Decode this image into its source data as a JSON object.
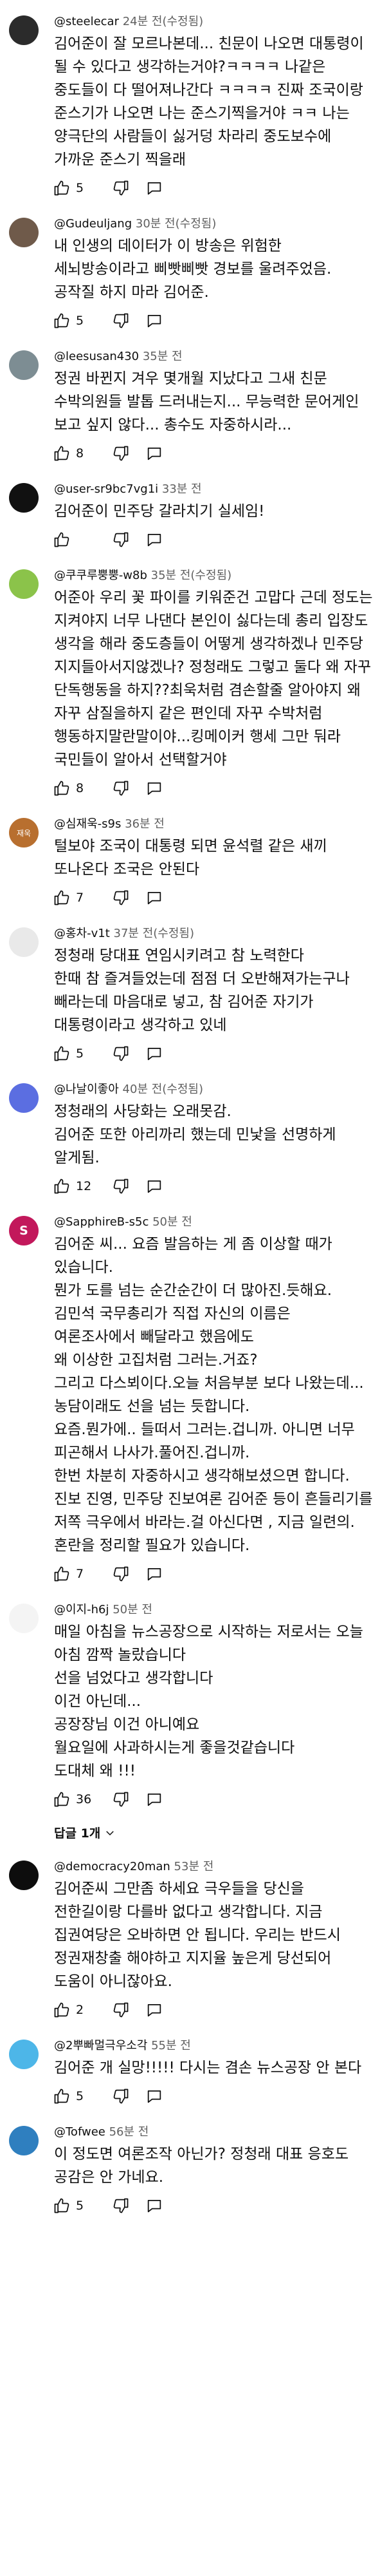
{
  "comments": [
    {
      "author": "@steelecar",
      "time": "24분 전(수정됨)",
      "avatar_color": "#2b2b2b",
      "avatar_text": "",
      "body": "김어준이 잘 모르나본데... 친문이 나오면 대통령이 될 수 있다고 생각하는거야?ㅋㅋㅋㅋ 나같은 중도들이 다 떨어져나간다 ㅋㅋㅋㅋ 진짜 조국이랑 준스기가 나오면 나는 준스기찍을거야 ㅋㅋ 나는 양극단의 사람들이 싫거덩 차라리 중도보수에 가까운 준스기 찍을래",
      "likes": "5"
    },
    {
      "author": "@Gudeuljang",
      "time": "30분 전(수정됨)",
      "avatar_color": "#6f5a4a",
      "avatar_text": "",
      "body": "내 인생의 데이터가 이 방송은 위험한 세뇌방송이라고 삐빳삐빳 경보를 울려주었음.\n공작질 하지 마라 김어준.",
      "likes": "5"
    },
    {
      "author": "@leesusan430",
      "time": "35분 전",
      "avatar_color": "#7d8d93",
      "avatar_text": "",
      "body": "정권 바뀐지 겨우 몇개월 지났다고 그새 친문 수박의원들 발톱 드러내는지... 무능력한 문어게인 보고 싶지 않다... 총수도 자중하시라...",
      "likes": "8"
    },
    {
      "author": "@user-sr9bc7vg1i",
      "time": "33분 전",
      "avatar_color": "#111111",
      "avatar_text": "",
      "body": "김어준이 민주당 갈라치기 실세임!",
      "likes": ""
    },
    {
      "author": "@쿠쿠루뿡뿡-w8b",
      "time": "35분 전(수정됨)",
      "avatar_color": "#8bc34a",
      "avatar_text": "",
      "body": "어준아 우리 꽃 파이를 키워준건 고맙다 근데 정도는 지켜야지 너무 나댄다 본인이 싫다는데 총리 입장도 생각을 해라 중도층들이 어떻게 생각하겠나 민주당 지지들아서지않겠나? 정청래도 그렇고 둘다 왜 자꾸 단독행동을 하지??최욱처럼 겸손할줄 알아야지 왜 자꾸 삼질을하지 같은 편인데 자꾸 수박처럼 행동하지말란말이야...킹메이커 행세 그만 둬라 국민들이 알아서 선택할거야",
      "likes": "8"
    },
    {
      "author": "@심재욱-s9s",
      "time": "36분 전",
      "avatar_color": "#b86f2f",
      "avatar_text": "재욱",
      "body": "털보야 조국이 대통령 되면 윤석렬 같은 새끼 또나온다 조국은 안된다",
      "likes": "7"
    },
    {
      "author": "@홍차-v1t",
      "time": "37분 전(수정됨)",
      "avatar_color": "#e9e9e9",
      "avatar_text": "",
      "body": "정청래 당대표 연임시키려고 참 노력한다\n한때 참 즐겨들었는데 점점 더 오반해져가는구나\n빼라는데 마음대로 넣고, 참 김어준 자기가 대통령이라고 생각하고 있네",
      "likes": "5"
    },
    {
      "author": "@나날이좋아",
      "time": "40분 전(수정됨)",
      "avatar_color": "#5b6ee1",
      "avatar_text": "",
      "body": "정청래의 사당화는 오래못감.\n김어준 또한 아리까리 했는데 민낯을 선명하게 알게됨.",
      "likes": "12"
    },
    {
      "author": "@SapphireB-s5c",
      "time": "50분 전",
      "avatar_color": "#c2185b",
      "avatar_text": "S",
      "body": "김어준 씨... 요즘 발음하는 게 좀 이상할 때가 있습니다.\n뭔가 도를 넘는 순간순간이 더 많아진.듯해요.\n김민석 국무총리가 직접 자신의 이름은 여론조사에서 빼달라고 했음에도\n왜 이상한 고집처럼 그러는.거죠?\n그리고 다스뵈이다.오늘 처음부분 보다 나왔는데...\n농담이래도 선을 넘는 듯합니다.\n요즘.뭔가에.. 들떠서 그러는.겁니까. 아니면 너무 피곤해서 나사가.풀어진.겁니까.\n한번 차분히 자중하시고 생각해보셨으면 합니다.\n진보 진영, 민주당 진보여론 김어준 등이 흔들리기를\n저쪽 극우에서 바라는.걸 아신다면 , 지금 일련의.\n혼란을 정리할 필요가 있습니다.",
      "likes": "7"
    },
    {
      "author": "@이지-h6j",
      "time": "50분 전",
      "avatar_color": "#f4f4f4",
      "avatar_text": "",
      "body": "매일 아침을 뉴스공장으로 시작하는 저로서는 오늘 아침 깜짝 놀랐습니다\n선을 넘었다고 생각합니다\n이건 아닌데...\n공장장님 이건 아니예요\n월요일에 사과하시는게 좋을것같습니다\n도대체 왜 !!!",
      "likes": "36",
      "replies": "답글 1개"
    },
    {
      "author": "@democracy20man",
      "time": "53분 전",
      "avatar_color": "#0d0d0d",
      "avatar_text": "",
      "body": "김어준씨 그만좀 하세요 극우들을 당신을 전한길이랑 다를바 없다고 생각합니다. 지금 집권여당은 오바하면 안 됩니다. 우리는 반드시 정권재창출 해야하고 지지율 높은게 당선되어 도움이 아니잖아요.",
      "likes": "2"
    },
    {
      "author": "@2뿌빠멀극우소각",
      "time": "55분 전",
      "avatar_color": "#4db6e8",
      "avatar_text": "",
      "body": "김어준   개  실망!!!!!  다시는  겸손  뉴스공장  안 본다",
      "likes": "5"
    },
    {
      "author": "@Tofwee",
      "time": "56분 전",
      "avatar_color": "#2f7fbf",
      "avatar_text": "",
      "body": "이 정도면 여론조작 아닌가? 정청래 대표 응호도 공감은 안 가네요.",
      "likes": "5"
    }
  ]
}
